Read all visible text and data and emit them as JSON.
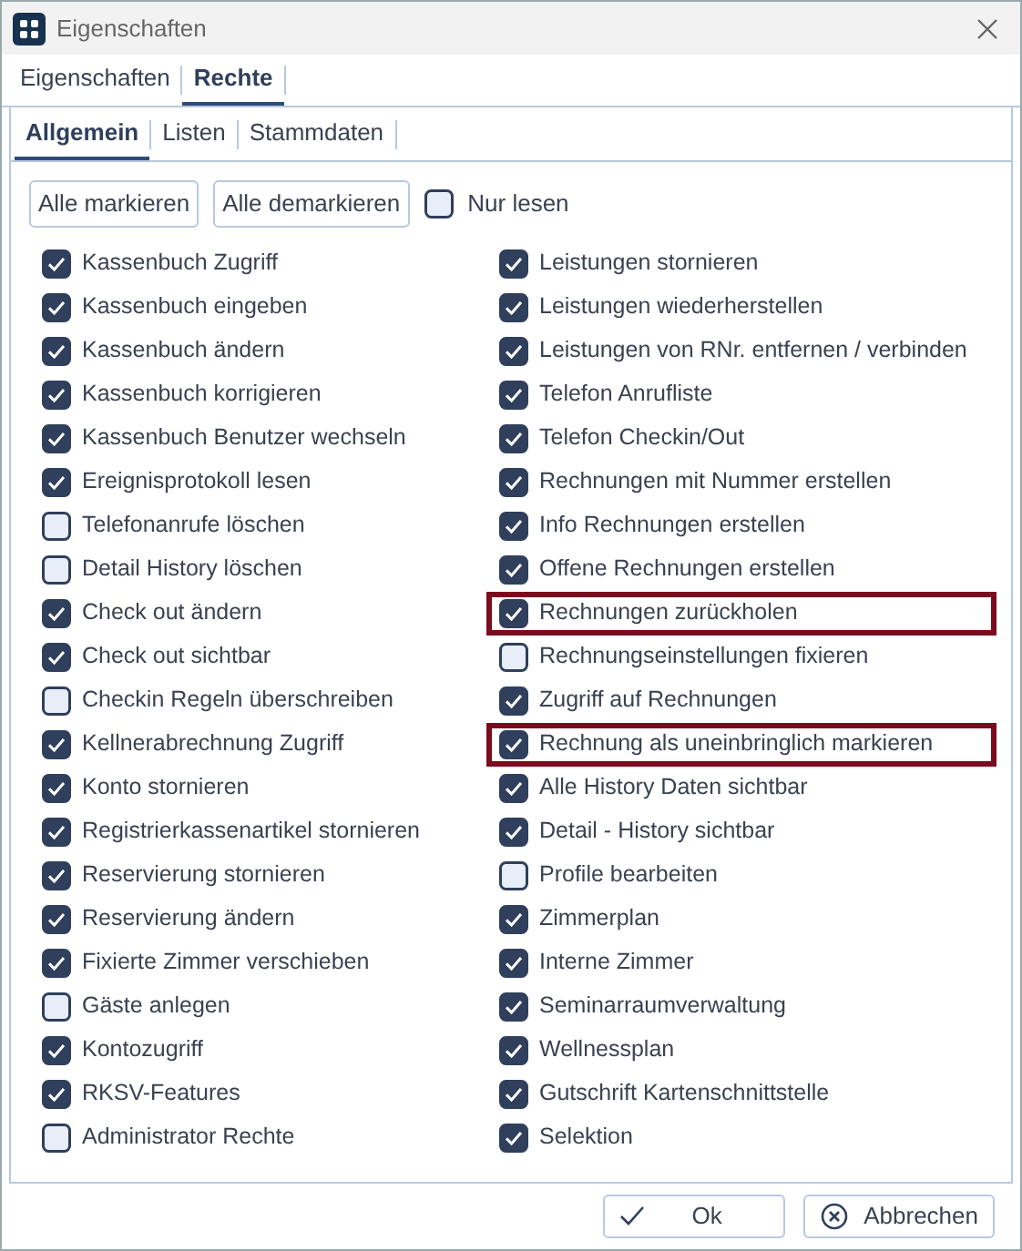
{
  "window": {
    "title": "Eigenschaften"
  },
  "tabs": [
    {
      "label": "Eigenschaften",
      "selected": false
    },
    {
      "label": "Rechte",
      "selected": true
    }
  ],
  "subtabs": [
    {
      "label": "Allgemein",
      "selected": true
    },
    {
      "label": "Listen",
      "selected": false
    },
    {
      "label": "Stammdaten",
      "selected": false
    }
  ],
  "toolbar": {
    "buttons": [
      "Alle markieren",
      "Alle demarkieren"
    ],
    "read_only": {
      "label": "Nur lesen",
      "checked": false
    }
  },
  "permissions": [
    [
      {
        "label": "Kassenbuch Zugriff",
        "checked": true,
        "highlighted": false
      },
      {
        "label": "Kassenbuch eingeben",
        "checked": true,
        "highlighted": false
      },
      {
        "label": "Kassenbuch ändern",
        "checked": true,
        "highlighted": false
      },
      {
        "label": "Kassenbuch korrigieren",
        "checked": true,
        "highlighted": false
      },
      {
        "label": "Kassenbuch Benutzer wechseln",
        "checked": true,
        "highlighted": false
      },
      {
        "label": "Ereignisprotokoll lesen",
        "checked": true,
        "highlighted": false
      },
      {
        "label": "Telefonanrufe löschen",
        "checked": false,
        "highlighted": false
      },
      {
        "label": "Detail History löschen",
        "checked": false,
        "highlighted": false
      },
      {
        "label": "Check out ändern",
        "checked": true,
        "highlighted": false
      },
      {
        "label": "Check out sichtbar",
        "checked": true,
        "highlighted": false
      },
      {
        "label": "Checkin Regeln überschreiben",
        "checked": false,
        "highlighted": false
      },
      {
        "label": "Kellnerabrechnung Zugriff",
        "checked": true,
        "highlighted": false
      },
      {
        "label": "Konto stornieren",
        "checked": true,
        "highlighted": false
      },
      {
        "label": "Registrierkassenartikel stornieren",
        "checked": true,
        "highlighted": false
      },
      {
        "label": "Reservierung stornieren",
        "checked": true,
        "highlighted": false
      },
      {
        "label": "Reservierung ändern",
        "checked": true,
        "highlighted": false
      },
      {
        "label": "Fixierte Zimmer verschieben",
        "checked": true,
        "highlighted": false
      },
      {
        "label": "Gäste anlegen",
        "checked": false,
        "highlighted": false
      },
      {
        "label": "Kontozugriff",
        "checked": true,
        "highlighted": false
      },
      {
        "label": "RKSV-Features",
        "checked": true,
        "highlighted": false
      },
      {
        "label": "Administrator Rechte",
        "checked": false,
        "highlighted": false
      }
    ],
    [
      {
        "label": "Leistungen stornieren",
        "checked": true,
        "highlighted": false
      },
      {
        "label": "Leistungen wiederherstellen",
        "checked": true,
        "highlighted": false
      },
      {
        "label": "Leistungen von RNr. entfernen / verbinden",
        "checked": true,
        "highlighted": false
      },
      {
        "label": "Telefon Anrufliste",
        "checked": true,
        "highlighted": false
      },
      {
        "label": "Telefon Checkin/Out",
        "checked": true,
        "highlighted": false
      },
      {
        "label": "Rechnungen mit Nummer erstellen",
        "checked": true,
        "highlighted": false
      },
      {
        "label": "Info Rechnungen erstellen",
        "checked": true,
        "highlighted": false
      },
      {
        "label": "Offene Rechnungen erstellen",
        "checked": true,
        "highlighted": false
      },
      {
        "label": "Rechnungen zurückholen",
        "checked": true,
        "highlighted": true
      },
      {
        "label": "Rechnungseinstellungen fixieren",
        "checked": false,
        "highlighted": false
      },
      {
        "label": "Zugriff auf Rechnungen",
        "checked": true,
        "highlighted": false
      },
      {
        "label": "Rechnung als uneinbringlich markieren",
        "checked": true,
        "highlighted": true
      },
      {
        "label": "Alle History Daten sichtbar",
        "checked": true,
        "highlighted": false
      },
      {
        "label": "Detail - History sichtbar",
        "checked": true,
        "highlighted": false
      },
      {
        "label": "Profile bearbeiten",
        "checked": false,
        "highlighted": false
      },
      {
        "label": "Zimmerplan",
        "checked": true,
        "highlighted": false
      },
      {
        "label": "Interne Zimmer",
        "checked": true,
        "highlighted": false
      },
      {
        "label": "Seminarraumverwaltung",
        "checked": true,
        "highlighted": false
      },
      {
        "label": "Wellnessplan",
        "checked": true,
        "highlighted": false
      },
      {
        "label": "Gutschrift Kartenschnittstelle",
        "checked": true,
        "highlighted": false
      },
      {
        "label": "Selektion",
        "checked": true,
        "highlighted": false
      }
    ]
  ],
  "footer": {
    "ok": "Ok",
    "cancel": "Abbrechen"
  }
}
